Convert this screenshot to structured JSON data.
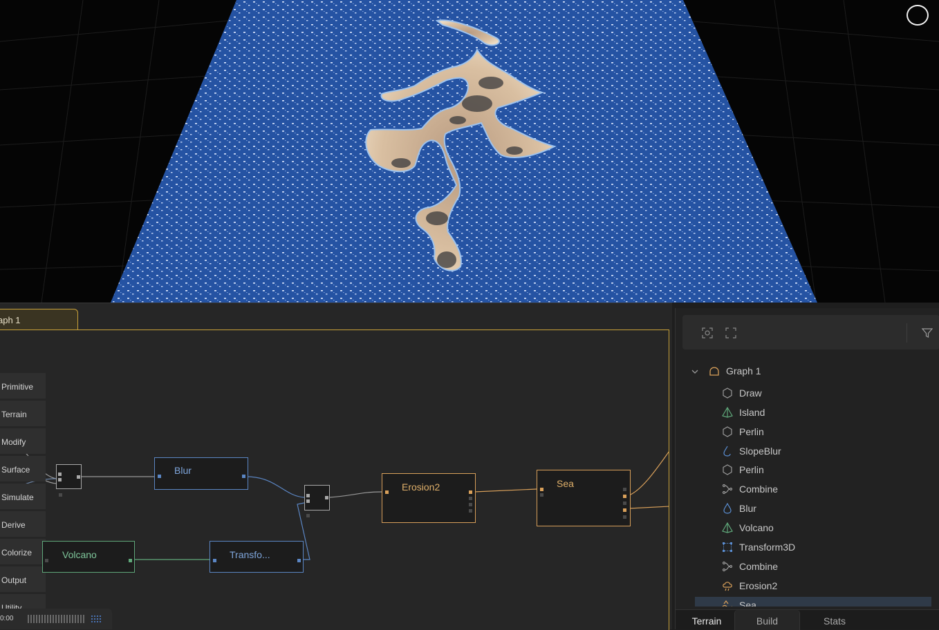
{
  "graph_tab": {
    "label": "aph 1"
  },
  "categories": [
    "Primitive",
    "Terrain",
    "Modify",
    "Surface",
    "Simulate",
    "Derive",
    "Colorize",
    "Output",
    "Utility"
  ],
  "nodes": {
    "blur": "Blur",
    "volcano": "Volcano",
    "transform": "Transfo...",
    "erosion": "Erosion2",
    "sea": "Sea"
  },
  "timeline": {
    "time": "0:00"
  },
  "tree": {
    "root": "Graph 1",
    "items": [
      {
        "label": "Draw",
        "icon": "hexagon-icon",
        "color": "#9a9a9a"
      },
      {
        "label": "Island",
        "icon": "pyramid-icon",
        "color": "#5fa87a"
      },
      {
        "label": "Perlin",
        "icon": "hexagon-icon",
        "color": "#9a9a9a"
      },
      {
        "label": "SlopeBlur",
        "icon": "drop-outline-icon",
        "color": "#5b8fd4"
      },
      {
        "label": "Perlin",
        "icon": "hexagon-icon",
        "color": "#9a9a9a"
      },
      {
        "label": "Combine",
        "icon": "combine-icon",
        "color": "#9a9a9a"
      },
      {
        "label": "Blur",
        "icon": "drop-icon",
        "color": "#5b8fd4"
      },
      {
        "label": "Volcano",
        "icon": "pyramid-icon",
        "color": "#5fa87a"
      },
      {
        "label": "Transform3D",
        "icon": "transform-icon",
        "color": "#5b8fd4"
      },
      {
        "label": "Combine",
        "icon": "combine-icon",
        "color": "#9a9a9a"
      },
      {
        "label": "Erosion2",
        "icon": "cloud-rain-icon",
        "color": "#d9a05a"
      },
      {
        "label": "Sea",
        "icon": "sea-icon",
        "color": "#d9a05a"
      }
    ]
  },
  "bottom_tabs": [
    "Terrain",
    "Build",
    "Stats"
  ],
  "colors": {
    "accent": "#c9a23a",
    "blue_node": "#5b86c4",
    "green_node": "#5fa87a",
    "orange_node": "#d9a05a"
  }
}
